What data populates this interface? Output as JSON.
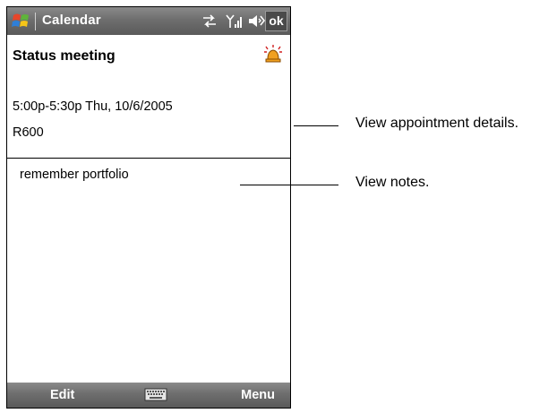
{
  "titlebar": {
    "title": "Calendar",
    "ok_label": "ok",
    "icons": [
      "windows-start-icon",
      "connectivity-icon",
      "signal-icon",
      "speaker-icon"
    ]
  },
  "appointment": {
    "subject": "Status meeting",
    "when": "5:00p-5:30p Thu, 10/6/2005",
    "location": "R600",
    "alarm_icon": "alarm-bell-icon"
  },
  "notes": {
    "text": "remember portfolio"
  },
  "menubar": {
    "left_label": "Edit",
    "right_label": "Menu",
    "center_icon": "keyboard-icon"
  },
  "callouts": {
    "details": "View appointment details.",
    "notes": "View notes."
  },
  "colors": {
    "bar_gradient_top": "#8a8a8a",
    "bar_gradient_bottom": "#5a5a5a",
    "alarm_orange": "#f0a020"
  }
}
